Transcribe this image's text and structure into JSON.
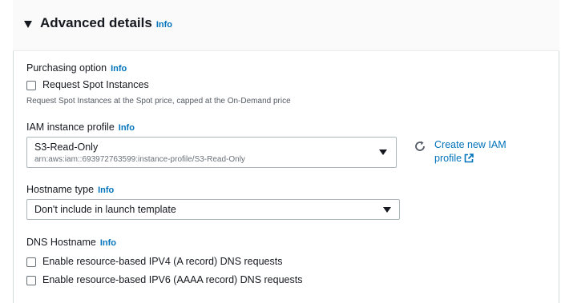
{
  "section": {
    "title": "Advanced details",
    "info": "Info"
  },
  "purchasing": {
    "label": "Purchasing option",
    "info": "Info",
    "spot_checkbox_label": "Request Spot Instances",
    "description": "Request Spot Instances at the Spot price, capped at the On-Demand price"
  },
  "iam": {
    "label": "IAM instance profile",
    "info": "Info",
    "selected_name": "S3-Read-Only",
    "selected_arn": "arn:aws:iam::693972763599:instance-profile/S3-Read-Only",
    "create_link": "Create new IAM profile"
  },
  "hostname": {
    "label": "Hostname type",
    "info": "Info",
    "selected": "Don't include in launch template"
  },
  "dns": {
    "label": "DNS Hostname",
    "info": "Info",
    "ipv4_label": "Enable resource-based IPV4 (A record) DNS requests",
    "ipv6_label": "Enable resource-based IPV6 (AAAA record) DNS requests"
  },
  "colors": {
    "link": "#0073bb",
    "text": "#16191f",
    "border": "#aab7b8"
  }
}
